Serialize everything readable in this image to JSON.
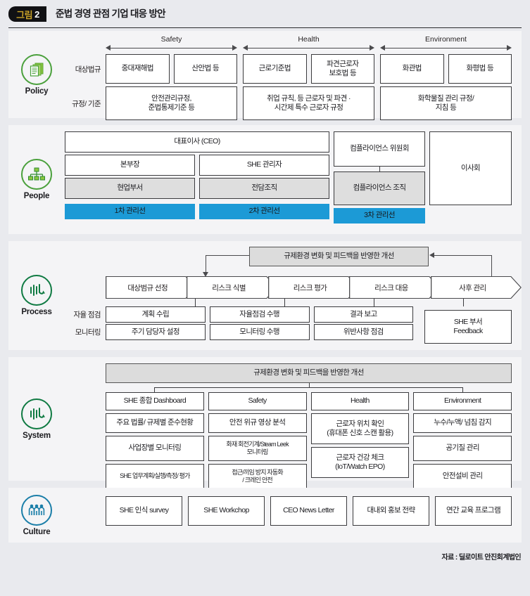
{
  "header": {
    "badge_word": "그림",
    "badge_num": "2",
    "title": "준법 경영 관점 기업 대응 방안"
  },
  "colors": {
    "accent_blue": "#1c9ad6",
    "icon_green": "#4aa03c",
    "icon_dark_green": "#0f7a42",
    "icon_teal": "#1a7ea8",
    "panel_bg": "#f4f4f6",
    "page_bg": "#e9eaee",
    "box_gray": "#dedede",
    "badge_gold": "#c9a227"
  },
  "policy": {
    "icon_name": "documents-stack-icon",
    "label": "Policy",
    "categories": [
      "Safety",
      "Health",
      "Environment"
    ],
    "row_labels": [
      "대상법규",
      "규정/ 기준"
    ],
    "laws": [
      [
        "중대재해법",
        "산안법 등"
      ],
      [
        "근로기준법",
        "파견근로자\n보호법 등"
      ],
      [
        "화관법",
        "화평법 등"
      ]
    ],
    "standards": [
      "안전관리규정,\n준법통제기준 등",
      "취업 규칙, 등 근로자 및 파견 ·\n시간제 특수 근로자 규정",
      "화학물질 관리 규정/\n지침 등"
    ]
  },
  "people": {
    "icon_name": "org-chart-icon",
    "label": "People",
    "ceo": "대표이사 (CEO)",
    "mid_row": [
      "본부장",
      "SHE 관리자"
    ],
    "low_row": [
      "현업부서",
      "전담조직"
    ],
    "committee": "컴플라이언스 위원회",
    "compliance_org": "컴플라이언스 조직",
    "board": "이사회",
    "lines": [
      "1차 관리선",
      "2차 관리선",
      "3차 관리선"
    ]
  },
  "process": {
    "icon_name": "process-wave-icon",
    "label": "Process",
    "improvement": "규제환경 변화 및 피드백을 반영한 개선",
    "steps": [
      "대상범규 선정",
      "리스크 식별",
      "리스크 평가",
      "리스크 대응",
      "사후 관리"
    ],
    "row_labels": [
      "자율 점검",
      "모니터링"
    ],
    "self_check": [
      "계획 수립",
      "자율점검 수행",
      "결과 보고"
    ],
    "monitoring": [
      "주기 담당자 설정",
      "모니터링 수행",
      "위반사항 점검"
    ],
    "feedback": "SHE 부서\nFeedback"
  },
  "system": {
    "icon_name": "system-wave-icon",
    "label": "System",
    "improvement": "규제환경 변화 및 피드백을 반영한 개선",
    "columns": [
      {
        "header": "SHE 종합 Dashboard",
        "items": [
          "주요 법률/ 규제별 준수현황",
          "사업장별 모니터링",
          "SHE 업무계획/실행/측정/ 평가"
        ]
      },
      {
        "header": "Safety",
        "items": [
          "안전 위규 영상 분석",
          "화재 회전기계/Steam Leek\n모니터링",
          "접근/끼임 방지 자동화\n/ 크레인 안전"
        ]
      },
      {
        "header": "Health",
        "items": [
          "근로자 위치 확인\n(휴대폰 신호 스캔 활용)",
          "근로자 건강 체크\n(IoT/Watch EPO)"
        ]
      },
      {
        "header": "Environment",
        "items": [
          "누수/누액/ 넘침 감지",
          "공기질 관리",
          "안전설비 관리"
        ]
      }
    ]
  },
  "culture": {
    "icon_name": "three-people-icon",
    "label": "Culture",
    "items": [
      "SHE 인식 survey",
      "SHE Workchop",
      "CEO News Letter",
      "대내외 홍보 전략",
      "연간 교육 프로그램"
    ]
  },
  "footer": {
    "source": "자료 : 딜로이트 안진회계법인"
  }
}
